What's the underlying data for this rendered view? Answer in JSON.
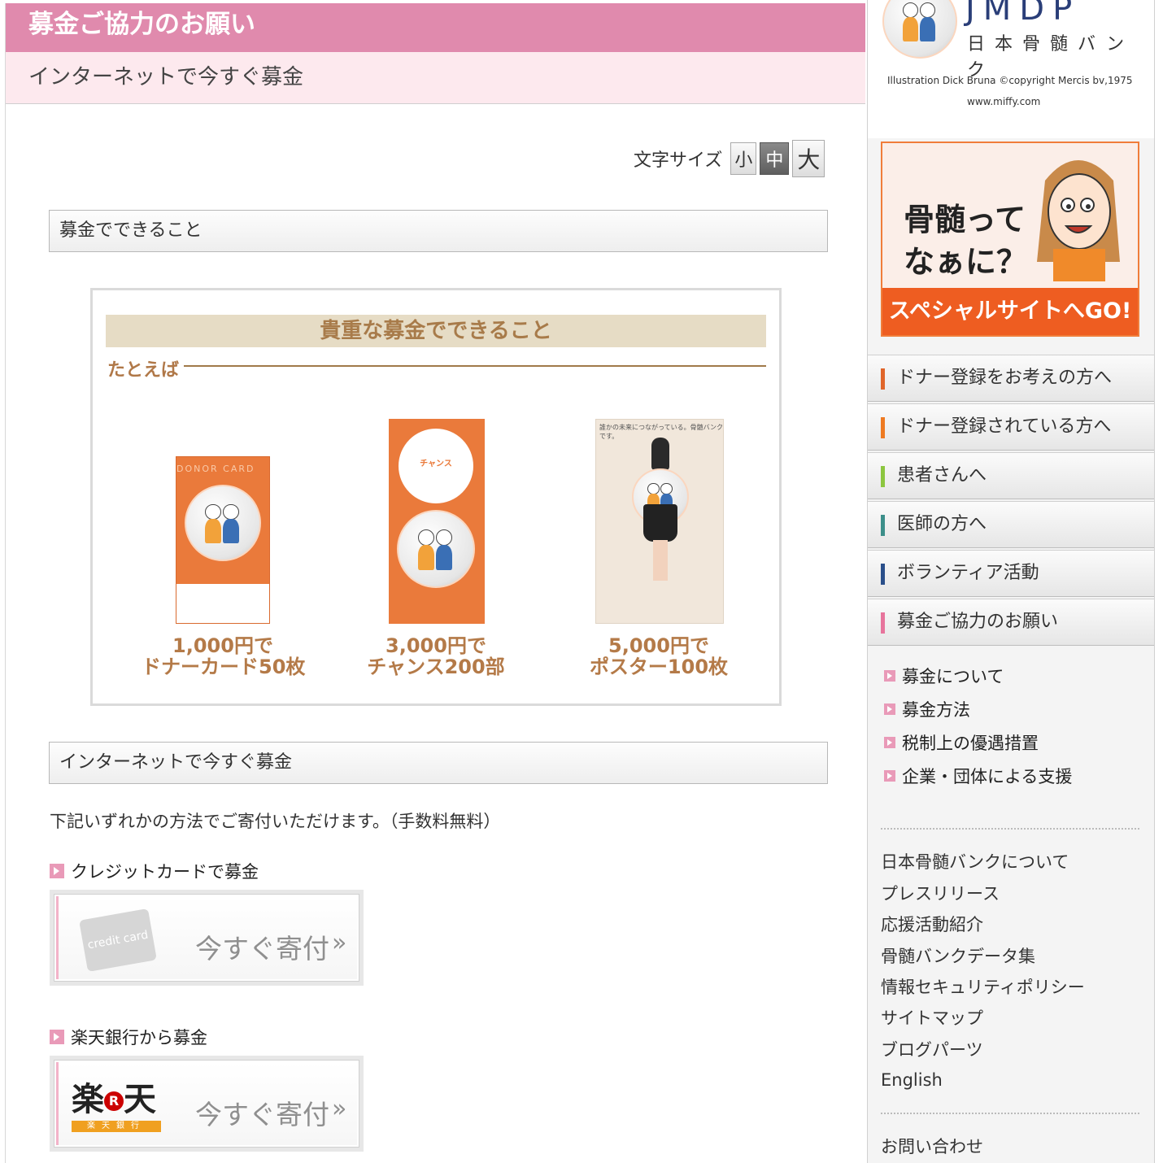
{
  "header": {
    "title": "募金ご協力のお願い",
    "subtitle": "インターネットで今すぐ募金"
  },
  "font_size": {
    "label": "文字サイズ",
    "small": "小",
    "medium": "中",
    "large": "大"
  },
  "section1": {
    "heading": "募金でできること"
  },
  "can_box": {
    "banner": "貴重な募金でできること",
    "tatoeba": "たとえば",
    "items": [
      {
        "line1": "1,000円で",
        "line2": "ドナーカード50枚",
        "card_top": "DONOR CARD"
      },
      {
        "line1": "3,000円で",
        "line2": "チャンス200部",
        "pamph_text": "チャンス"
      },
      {
        "line1": "5,000円で",
        "line2": "ポスター100枚",
        "poster_text": "誰かの未来につながっている。骨髄バンクです。"
      }
    ]
  },
  "section2": {
    "heading": "インターネットで今すぐ募金",
    "intro": "下記いずれかの方法でご寄付いただけます。（手数料無料）",
    "credit": {
      "heading": "クレジットカードで募金",
      "logo": "credit card",
      "button": "今すぐ寄付",
      "chevron": "»"
    },
    "rakuten": {
      "heading": "楽天銀行から募金",
      "logo_kanji_left": "楽",
      "logo_r": "R",
      "logo_kanji_right": "天",
      "logo_bar": "楽天銀行",
      "button": "今すぐ寄付",
      "chevron": "»"
    }
  },
  "sidebar": {
    "logo": {
      "letters": "JMDP",
      "name": "日本骨髄バンク",
      "credit": "Illustration Dick Bruna ©copyright Mercis bv,1975",
      "url": "www.miffy.com"
    },
    "special": {
      "question1": "骨髄って",
      "question2": "なぁに？",
      "go": "スペシャルサイトへGO!"
    },
    "nav": [
      {
        "label": "ドナー登録をお考えの方へ",
        "color": "#e0652a"
      },
      {
        "label": "ドナー登録されている方へ",
        "color": "#ee7a22"
      },
      {
        "label": "患者さんへ",
        "color": "#8cc63f"
      },
      {
        "label": "医師の方へ",
        "color": "#3c8f8a"
      },
      {
        "label": "ボランティア活動",
        "color": "#2a4f8a"
      },
      {
        "label": "募金ご協力のお願い",
        "color": "#e7749c"
      }
    ],
    "sub_links": [
      "募金について",
      "募金方法",
      "税制上の優遇措置",
      "企業・団体による支援"
    ],
    "footer_links": [
      "日本骨髄バンクについて",
      "プレスリリース",
      "応援活動紹介",
      "骨髄バンクデータ集",
      "情報セキュリティポリシー",
      "サイトマップ",
      "ブログパーツ",
      "English"
    ],
    "contact": "お問い合わせ"
  }
}
